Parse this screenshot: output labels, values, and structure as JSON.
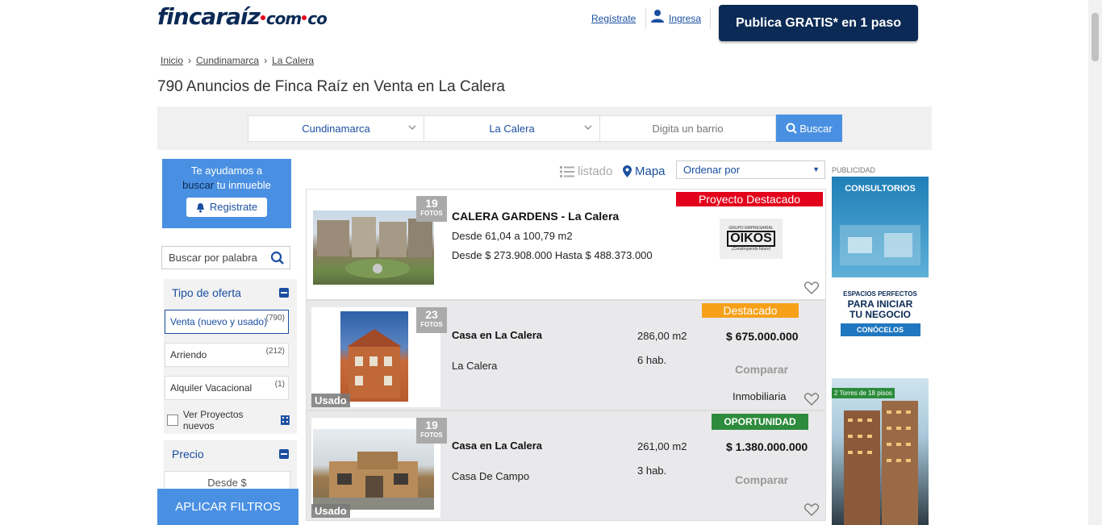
{
  "header": {
    "logo_main": "fincaraíz",
    "logo_com": "com",
    "logo_co": "co",
    "registrate": "Regístrate",
    "ingresa": "Ingresa",
    "publica": "Publica GRATIS* en 1 paso"
  },
  "breadcrumb": [
    "Inicio",
    "Cundinamarca",
    "La Calera"
  ],
  "page_title": "790 Anuncios de Finca Raíz en Venta en La Calera",
  "search": {
    "department": "Cundinamarca",
    "city": "La Calera",
    "barrio_placeholder": "Digita un barrio",
    "button": "Buscar"
  },
  "sidebar": {
    "help_line1": "Te ayudamos a",
    "help_hl": "buscar",
    "help_line2": " tu inmueble",
    "help_button": "Registrate",
    "keyword_placeholder": "Buscar por palabra",
    "tipo_oferta": "Tipo de oferta",
    "options": [
      {
        "label": "Venta (nuevo y usado)",
        "count": "(790)"
      },
      {
        "label": "Arriendo",
        "count": "(212)"
      },
      {
        "label": "Alquiler Vacacional",
        "count": "(1)"
      }
    ],
    "ver_proyectos": "Ver Proyectos nuevos",
    "precio": "Precio",
    "desde": "Desde $",
    "aplicar": "APLICAR FILTROS"
  },
  "toolbar": {
    "listado": "listado",
    "mapa": "Mapa",
    "ordenar": "Ordenar por"
  },
  "listings": [
    {
      "photos": "19",
      "photos_label": "FOTOS",
      "ribbon": "Proyecto Destacado",
      "title": "CALERA GARDENS - La Calera",
      "area": "Desde 61,04 a 100,79 m2",
      "price": "Desde $ 273.908.000 Hasta $ 488.373.000",
      "builder_small": "GRUPO EMPRESARIAL",
      "builder": "OIKOS",
      "builder_tag": "¡Construyendo futuro!"
    },
    {
      "photos": "23",
      "photos_label": "FOTOS",
      "ribbon": "Destacado",
      "title": "Casa en La Calera",
      "area": "286,00 m2",
      "price": "$ 675.000.000",
      "location": "La Calera",
      "rooms": "6 hab.",
      "comparar": "Comparar",
      "seller": "Inmobiliaria",
      "usado": "Usado"
    },
    {
      "photos": "19",
      "photos_label": "FOTOS",
      "ribbon": "OPORTUNIDAD",
      "title": "Casa en La Calera",
      "area": "261,00 m2",
      "price": "$ 1.380.000.000",
      "location": "Casa De Campo",
      "rooms": "3 hab.",
      "comparar": "Comparar",
      "usado": "Usado"
    }
  ],
  "ads": {
    "label": "PUBLICIDAD",
    "ad1_title": "CONSULTORIOS",
    "ad1_small": "ESPACIOS PERFECTOS",
    "ad1_big1": "PARA INICIAR",
    "ad1_big2": "TU NEGOCIO",
    "ad1_button": "CONÓCELOS",
    "ad2_tag": "2 Torres de 18 pisos"
  },
  "colors": {
    "brand_dark": "#0b2a55",
    "accent_blue": "#4a90e2",
    "ribbon_red": "#e3001b",
    "ribbon_orange": "#f7a11a",
    "ribbon_green": "#2e8b3d"
  }
}
